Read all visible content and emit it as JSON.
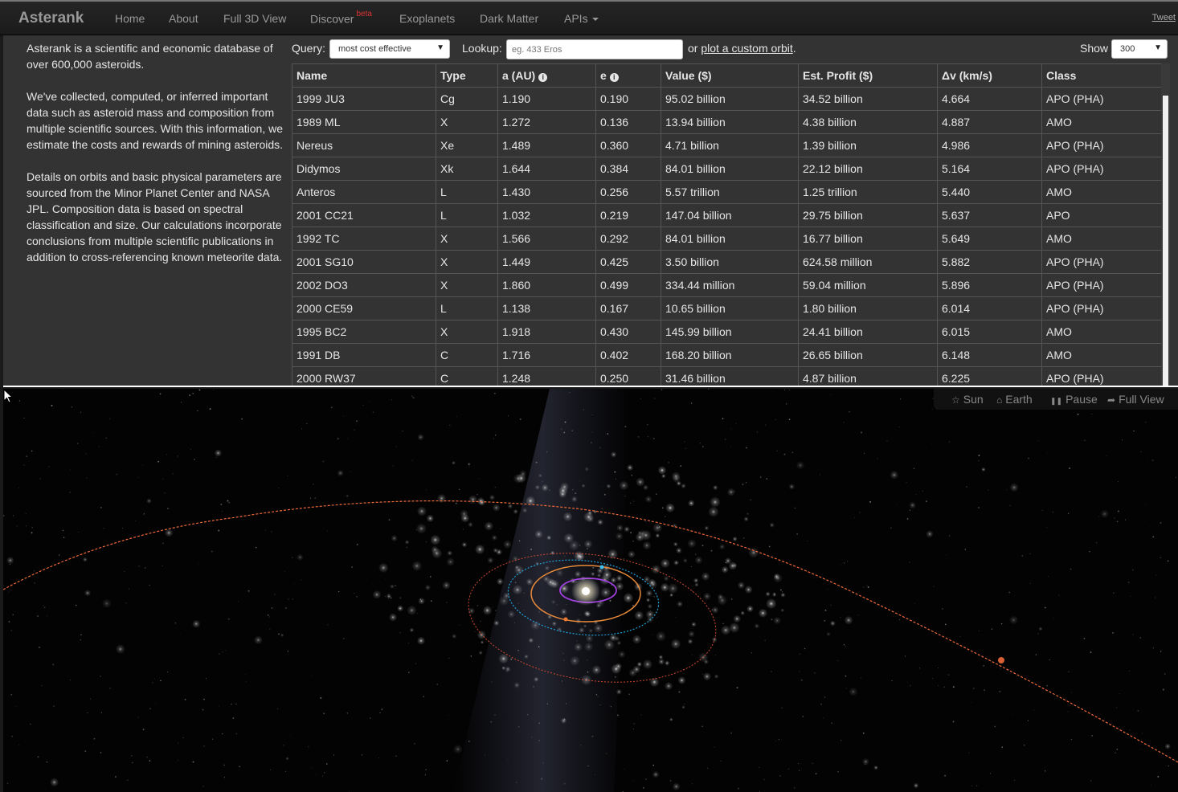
{
  "nav": {
    "brand": "Asterank",
    "items": [
      "Home",
      "About",
      "Full 3D View",
      "Discover",
      "Exoplanets",
      "Dark Matter",
      "APIs"
    ],
    "discover_badge": "beta",
    "tweet": "Tweet"
  },
  "intro": {
    "paragraphs": [
      "Asterank is a scientific and economic database of over 600,000 asteroids.",
      "We've collected, computed, or inferred important data such as asteroid mass and composition from multiple scientific sources. With this information, we estimate the costs and rewards of mining asteroids.",
      "Details on orbits and basic physical parameters are sourced from the Minor Planet Center and NASA JPL. Composition data is based on spectral classification and size. Our calculations incorporate conclusions from multiple scientific publications in addition to cross-referencing known meteorite data."
    ]
  },
  "controls": {
    "query_label": "Query:",
    "query_value": "most cost effective",
    "lookup_label": "Lookup:",
    "lookup_placeholder": "eg. 433 Eros",
    "or_text": "or",
    "custom_orbit_link": "plot a custom orbit",
    "period": ".",
    "show_label": "Show",
    "show_value": "300"
  },
  "table": {
    "headers": [
      "Name",
      "Type",
      "a (AU)",
      "e",
      "Value ($)",
      "Est. Profit ($)",
      "Δv (km/s)",
      "Class"
    ],
    "rows": [
      [
        "1999 JU3",
        "Cg",
        "1.190",
        "0.190",
        "95.02 billion",
        "34.52 billion",
        "4.664",
        "APO (PHA)"
      ],
      [
        "1989 ML",
        "X",
        "1.272",
        "0.136",
        "13.94 billion",
        "4.38 billion",
        "4.887",
        "AMO"
      ],
      [
        "Nereus",
        "Xe",
        "1.489",
        "0.360",
        "4.71 billion",
        "1.39 billion",
        "4.986",
        "APO (PHA)"
      ],
      [
        "Didymos",
        "Xk",
        "1.644",
        "0.384",
        "84.01 billion",
        "22.12 billion",
        "5.164",
        "APO (PHA)"
      ],
      [
        "Anteros",
        "L",
        "1.430",
        "0.256",
        "5.57 trillion",
        "1.25 trillion",
        "5.440",
        "AMO"
      ],
      [
        "2001 CC21",
        "L",
        "1.032",
        "0.219",
        "147.04 billion",
        "29.75 billion",
        "5.637",
        "APO"
      ],
      [
        "1992 TC",
        "X",
        "1.566",
        "0.292",
        "84.01 billion",
        "16.77 billion",
        "5.649",
        "AMO"
      ],
      [
        "2001 SG10",
        "X",
        "1.449",
        "0.425",
        "3.50 billion",
        "624.58 million",
        "5.882",
        "APO (PHA)"
      ],
      [
        "2002 DO3",
        "X",
        "1.860",
        "0.499",
        "334.44 million",
        "59.04 million",
        "5.896",
        "APO (PHA)"
      ],
      [
        "2000 CE59",
        "L",
        "1.138",
        "0.167",
        "10.65 billion",
        "1.80 billion",
        "6.014",
        "APO (PHA)"
      ],
      [
        "1995 BC2",
        "X",
        "1.918",
        "0.430",
        "145.99 billion",
        "24.41 billion",
        "6.015",
        "AMO"
      ],
      [
        "1991 DB",
        "C",
        "1.716",
        "0.402",
        "168.20 billion",
        "26.65 billion",
        "6.148",
        "AMO"
      ],
      [
        "2000 RW37",
        "C",
        "1.248",
        "0.250",
        "31.46 billion",
        "4.87 billion",
        "6.225",
        "APO (PHA)"
      ]
    ]
  },
  "view_controls": [
    {
      "icon": "star-icon",
      "glyph": "☆",
      "label": "Sun"
    },
    {
      "icon": "home-icon",
      "glyph": "⌂",
      "label": "Earth"
    },
    {
      "icon": "pause-icon",
      "glyph": "❚❚",
      "label": "Pause"
    },
    {
      "icon": "share-icon",
      "glyph": "➦",
      "label": "Full View"
    }
  ],
  "colors": {
    "panel_bg": "#333333",
    "orbit_earth": "#1fa0d8",
    "orbit_mars": "#e0652a",
    "orbit_venus": "#e88a3a",
    "orbit_mercury": "#a040e0",
    "orbit_asteroid": "#f06a3a"
  }
}
